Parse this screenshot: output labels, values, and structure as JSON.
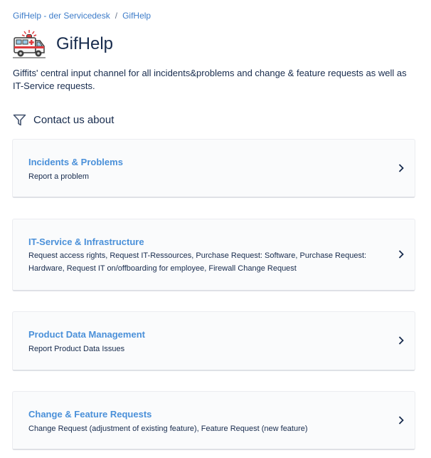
{
  "breadcrumb": {
    "items": [
      "GifHelp - der Servicedesk",
      "GifHelp"
    ],
    "separator": "/"
  },
  "header": {
    "logo_icon": "ambulance-icon",
    "title": "GifHelp"
  },
  "description": "Giffits' central input channel for all incidents&problems and change & feature requests as well as IT-Service requests.",
  "section": {
    "icon": "filter-icon",
    "title": "Contact us about"
  },
  "request_types": [
    {
      "title": "Incidents & Problems",
      "description": "Report a problem"
    },
    {
      "title": "IT-Service & Infrastructure",
      "description": "Request access rights, Request IT-Ressources, Purchase Request: Software, Purchase Request: Hardware, Request IT on/offboarding for employee, Firewall Change Request"
    },
    {
      "title": "Product Data Management",
      "description": "Report Product Data Issues"
    },
    {
      "title": "Change & Feature Requests",
      "description": "Change Request (adjustment of existing feature), Feature Request (new feature)"
    }
  ],
  "colors": {
    "link": "#3d7cc9",
    "card_title": "#4a90d9",
    "text": "#172b4d",
    "card_bg": "#fafbfc"
  }
}
